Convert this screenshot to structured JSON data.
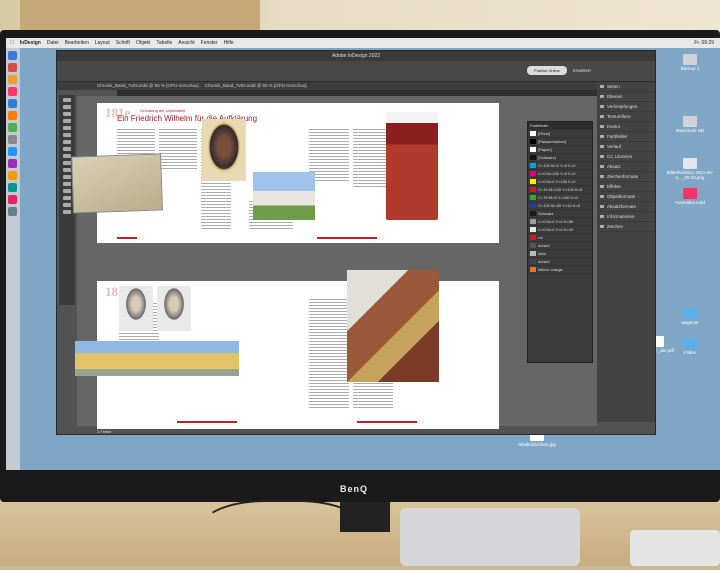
{
  "scene": "Monitor showing Adobe InDesign",
  "menubar": {
    "app": "InDesign",
    "items": [
      "Datei",
      "Bearbeiten",
      "Layout",
      "Schrift",
      "Objekt",
      "Tabelle",
      "Ansicht",
      "Fenster",
      "Hilfe"
    ],
    "clock": "Fr. 09:29"
  },
  "indesign": {
    "window_title": "Adobe InDesign 2022",
    "publish_button": "Publish Online",
    "workspace": "Erweitert",
    "tabs": [
      "Chronik_Band_7v03.indd @ 50 % [GPU-Vorschau]",
      "Chronik_Band_7v03.indd @ 50 % [GPU-Vorschau]"
    ],
    "panels": [
      "Seiten",
      "Ebenen",
      "Verknüpfungen",
      "Textumfluss",
      "Kontur",
      "Farbfelder",
      "Verlauf",
      "CC Libraries",
      "Absatz",
      "Zeichenformate",
      "Effekte",
      "Objektformate",
      "Absatzformate",
      "Informationen",
      "Zeichen"
    ],
    "swatch_panel_title": "Farbfelder",
    "swatches": [
      {
        "name": "[Ohne]",
        "color": "#ffffff"
      },
      {
        "name": "[Passermarken]",
        "color": "#000000"
      },
      {
        "name": "[Papier]",
        "color": "#ffffff"
      },
      {
        "name": "[Schwarz]",
        "color": "#111111"
      },
      {
        "name": "C=100 M=0 Y=0 K=0",
        "color": "#00a0e3"
      },
      {
        "name": "C=0 M=100 Y=0 K=0",
        "color": "#e4007d"
      },
      {
        "name": "C=0 M=0 Y=100 K=0",
        "color": "#ffed00"
      },
      {
        "name": "C=15 M=100 Y=100 K=0",
        "color": "#c31f2b"
      },
      {
        "name": "C=75 M=5 Y=100 K=0",
        "color": "#3ba23a"
      },
      {
        "name": "C=100 M=90 Y=10 K=0",
        "color": "#263d8f"
      },
      {
        "name": "Schwarz",
        "color": "#1a1a1a"
      },
      {
        "name": "C=0 M=0 Y=0 K=50",
        "color": "#9c9c9c"
      },
      {
        "name": "C=0 M=0 Y=0 K=10",
        "color": "#e6e6e6"
      },
      {
        "name": "rot",
        "color": "#c31f2b"
      },
      {
        "name": "dunkel",
        "color": "#555555"
      },
      {
        "name": "klein",
        "color": "#bbbbbb"
      },
      {
        "name": "dunkel",
        "color": "#444444"
      },
      {
        "name": "bittere orange",
        "color": "#e07a2a"
      }
    ],
    "status": "1 Fehler"
  },
  "spread1": {
    "big_year": "181e",
    "kicker": "Gründung der Universität",
    "heading": "Ein Friedrich Wilhelm für die Aufklärung"
  },
  "spread2": {
    "big_year": "181e"
  },
  "desktop_icons": [
    {
      "label": "Backup 1"
    },
    {
      "label": "Backup 3"
    },
    {
      "label": "Macintosh HD"
    },
    {
      "label": "Bilderfunktion 2021-06-1..._00.33.png"
    },
    {
      "label": "Actenidee.indd"
    },
    {
      "label": "wegener"
    },
    {
      "label": "Fildes"
    },
    {
      "label": "Holsiden_der.pdf"
    },
    {
      "label": "Inhaltsbildchen.jpg"
    }
  ],
  "monitor_brand": "BenQ"
}
